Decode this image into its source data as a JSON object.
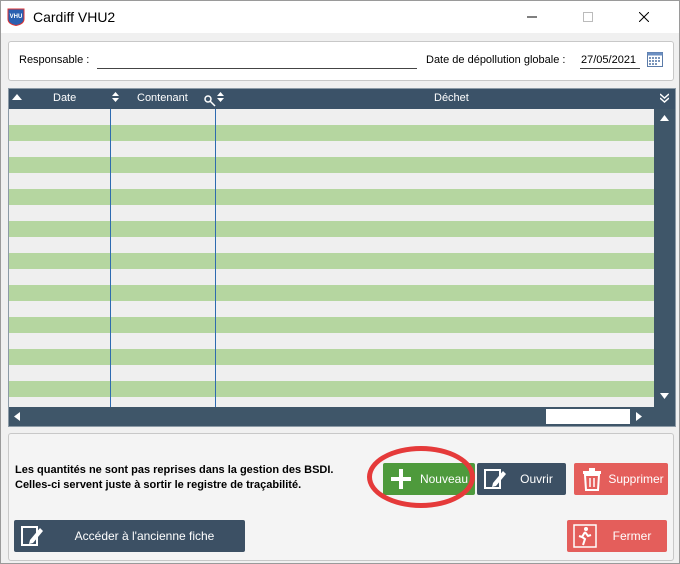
{
  "window": {
    "title": "Cardiff VHU2",
    "icon_text": "VHU"
  },
  "form": {
    "responsable_label": "Responsable :",
    "responsable_value": "",
    "date_label": "Date de dépollution globale :",
    "date_value": "27/05/2021"
  },
  "grid": {
    "columns": [
      "Date",
      "Contenant",
      "Déchet"
    ],
    "row_count": 18
  },
  "note": {
    "line1": "Les quantités ne sont pas reprises dans la gestion des BSDI.",
    "line2": "Celles-ci servent juste à sortir le registre de traçabilité."
  },
  "buttons": {
    "new": "Nouveau",
    "open": "Ouvrir",
    "delete": "Supprimer",
    "old_sheet": "Accéder à l'ancienne fiche",
    "close": "Fermer"
  },
  "colors": {
    "header": "#3b5268",
    "row_alt": "#b5d6a0",
    "new_button": "#4e9a3c",
    "dark_button": "#3c5064",
    "red_button": "#e45e5b",
    "highlight": "#e53a3a"
  }
}
